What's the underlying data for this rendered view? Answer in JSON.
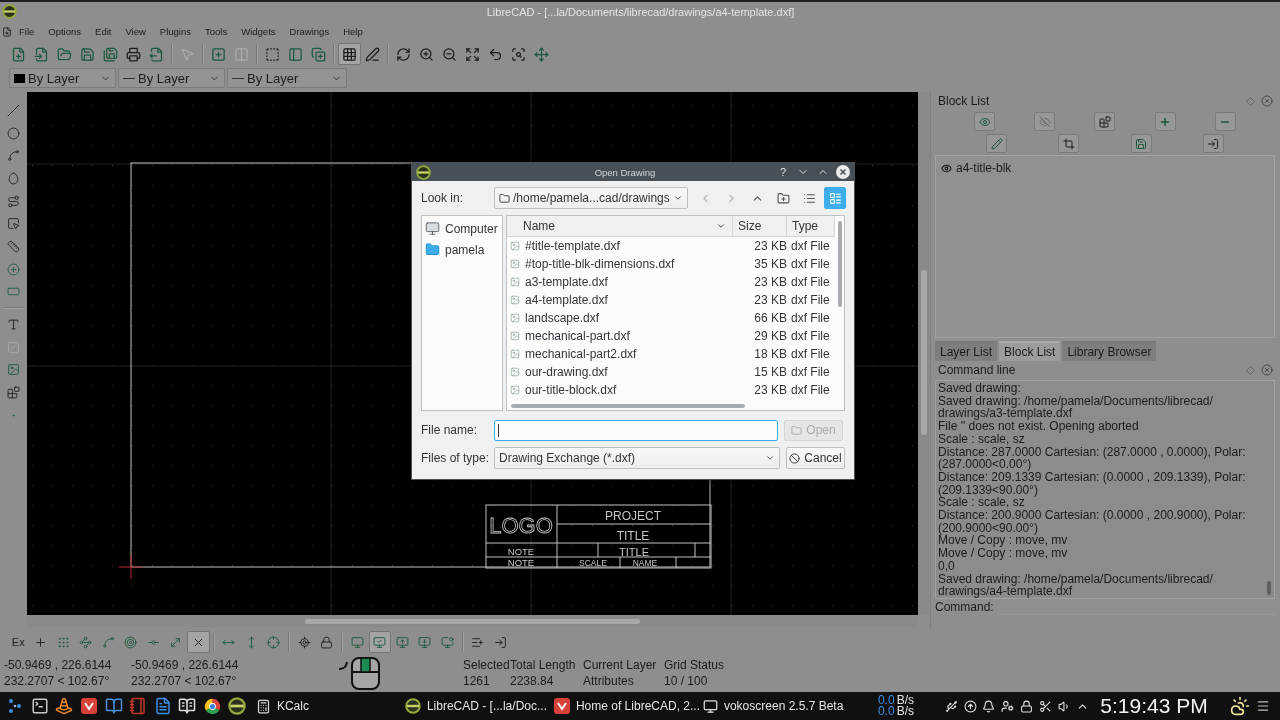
{
  "window": {
    "title": "LibreCAD - [...la/Documents/librecad/drawings/a4-template.dxf]"
  },
  "menu": [
    "File",
    "Options",
    "Edit",
    "View",
    "Plugins",
    "Tools",
    "Widgets",
    "Drawings",
    "Help"
  ],
  "main_toolbar": [
    [
      {
        "kind": "new",
        "on": false,
        "disabled": false
      },
      {
        "kind": "template",
        "on": false,
        "disabled": false
      },
      {
        "kind": "open",
        "on": false,
        "disabled": false
      },
      {
        "kind": "save",
        "on": false,
        "disabled": false
      },
      {
        "kind": "saveas",
        "on": false,
        "disabled": false
      },
      {
        "kind": "print",
        "on": false,
        "disabled": false
      },
      {
        "kind": "export",
        "on": false,
        "disabled": false
      }
    ],
    [
      {
        "kind": "select",
        "on": false,
        "disabled": true
      }
    ],
    [
      {
        "kind": "block",
        "on": false,
        "disabled": false
      },
      {
        "kind": "columns",
        "on": false,
        "disabled": true
      }
    ],
    [
      {
        "kind": "window",
        "on": false,
        "disabled": false
      },
      {
        "kind": "split",
        "on": false,
        "disabled": false
      },
      {
        "kind": "addview",
        "on": false,
        "disabled": false
      }
    ],
    [
      {
        "kind": "grid",
        "on": true,
        "disabled": false
      },
      {
        "kind": "draft",
        "on": false,
        "disabled": false
      }
    ],
    [
      {
        "kind": "redraw",
        "on": false,
        "disabled": false
      },
      {
        "kind": "zoomin",
        "on": false,
        "disabled": false
      },
      {
        "kind": "zoomout",
        "on": false,
        "disabled": false
      },
      {
        "kind": "autozoom",
        "on": false,
        "disabled": false
      },
      {
        "kind": "previous",
        "on": false,
        "disabled": false
      },
      {
        "kind": "zoomwindow",
        "on": false,
        "disabled": false
      },
      {
        "kind": "pan",
        "on": false,
        "disabled": false
      }
    ]
  ],
  "pen_toolbar": [
    {
      "kind": "color",
      "value": "By Layer"
    },
    {
      "kind": "width",
      "value": "By Layer"
    },
    {
      "kind": "linetype",
      "value": "By Layer"
    }
  ],
  "draw_toolbar": [
    [
      {
        "kind": "line",
        "disabled": false
      },
      {
        "kind": "circle",
        "disabled": false
      },
      {
        "kind": "spline",
        "disabled": false
      },
      {
        "kind": "ellipse",
        "disabled": false
      },
      {
        "kind": "polyline",
        "disabled": false
      },
      {
        "kind": "select",
        "disabled": false
      },
      {
        "kind": "dimension",
        "disabled": false
      },
      {
        "kind": "modify",
        "disabled": false
      },
      {
        "kind": "measure",
        "disabled": false
      }
    ],
    [
      {
        "kind": "text",
        "disabled": false
      },
      {
        "kind": "hatch",
        "disabled": true
      },
      {
        "kind": "image",
        "disabled": false
      },
      {
        "kind": "insert",
        "disabled": false
      },
      {
        "kind": "point",
        "disabled": false
      }
    ]
  ],
  "drawing": {
    "title_block": [
      "LOGO",
      "PROJECT",
      "TITLE",
      "NOTE",
      "TITLE",
      "NOTE",
      "SCALE",
      "NAME"
    ]
  },
  "open_dialog": {
    "title": "Open Drawing",
    "help": "?",
    "look_in_label": "Look in:",
    "look_in": "/home/pamela...cad/drawings",
    "nav_buttons": [
      {
        "kind": "back",
        "disabled": true,
        "selected": false
      },
      {
        "kind": "forward",
        "disabled": true,
        "selected": false
      },
      {
        "kind": "up",
        "disabled": false,
        "selected": false
      },
      {
        "kind": "newfolder",
        "disabled": false,
        "selected": false
      },
      {
        "kind": "listview",
        "disabled": false,
        "selected": false
      },
      {
        "kind": "detailview",
        "disabled": false,
        "selected": true
      }
    ],
    "places": [
      {
        "kind": "computer",
        "label": "Computer"
      },
      {
        "kind": "home",
        "label": "pamela"
      }
    ],
    "columns": [
      "Name",
      "Size",
      "Type"
    ],
    "files": [
      {
        "name": "#title-template.dxf",
        "size": "23 KB",
        "type": "dxf File"
      },
      {
        "name": "#top-title-blk-dimensions.dxf",
        "size": "35 KB",
        "type": "dxf File"
      },
      {
        "name": "a3-template.dxf",
        "size": "23 KB",
        "type": "dxf File"
      },
      {
        "name": "a4-template.dxf",
        "size": "23 KB",
        "type": "dxf File"
      },
      {
        "name": "landscape.dxf",
        "size": "66 KB",
        "type": "dxf File"
      },
      {
        "name": "mechanical-part.dxf",
        "size": "29 KB",
        "type": "dxf File"
      },
      {
        "name": "mechanical-part2.dxf",
        "size": "18 KB",
        "type": "dxf File"
      },
      {
        "name": "our-drawing.dxf",
        "size": "15 KB",
        "type": "dxf File"
      },
      {
        "name": "our-title-block.dxf",
        "size": "23 KB",
        "type": "dxf File"
      }
    ],
    "file_name": {
      "label": "File name:",
      "focused": true
    },
    "open_button": {
      "label": "Open",
      "disabled": true
    },
    "file_type": {
      "label": "Files of type:",
      "value": "Drawing Exchange (*.dxf)"
    },
    "cancel_button": {
      "label": "Cancel"
    }
  },
  "block_dock": {
    "title": "Block List",
    "blocks": [
      {
        "name": "a4-title-blk",
        "visible": true
      }
    ]
  },
  "dock_tabs": [
    {
      "label": "Layer List",
      "selected": false
    },
    {
      "label": "Block List",
      "selected": true
    },
    {
      "label": "Library Browser",
      "selected": false
    }
  ],
  "command_dock": {
    "title": "Command line",
    "lines": [
      "Saved drawing:",
      "Saved drawing: /home/pamela/Documents/librecad/",
      "drawings/a3-template.dxf",
      "File '' does not exist. Opening aborted",
      "Scale : scale, sz",
      "Distance: 287.0000 Cartesian: (287.0000 , 0.0000), Polar:",
      "(287.0000<0.00°)",
      "Distance: 209.1339 Cartesian: (0.0000 , 209.1339), Polar:",
      "(209.1339<90.00°)",
      "Scale : scale, sz",
      "Distance: 200.9000 Cartesian: (0.0000 , 200.9000), Polar:",
      "(200.9000<90.00°)",
      "Move / Copy : move, mv",
      "Move / Copy : move, mv",
      "0,0",
      "Saved drawing: /home/pamela/Documents/librecad/",
      "drawings/a4-template.dxf"
    ],
    "prompt": "Command:"
  },
  "snap_toolbar": [
    [
      {
        "kind": "exclusive",
        "label": "Ex",
        "on": false
      },
      {
        "kind": "free",
        "on": false
      },
      {
        "kind": "grid",
        "on": false
      },
      {
        "kind": "endpoint",
        "on": false
      },
      {
        "kind": "entity",
        "on": false
      },
      {
        "kind": "center",
        "on": false
      },
      {
        "kind": "middle",
        "on": false
      },
      {
        "kind": "distance",
        "on": false
      },
      {
        "kind": "intersection",
        "on": true
      }
    ],
    [
      {
        "kind": "horizontal",
        "on": false
      },
      {
        "kind": "vertical",
        "on": false
      },
      {
        "kind": "ortho",
        "on": false
      }
    ],
    [
      {
        "kind": "relzero",
        "on": false
      },
      {
        "kind": "lockzero",
        "on": false
      }
    ],
    [
      {
        "kind": "view1",
        "on": false
      },
      {
        "kind": "view2",
        "on": true
      },
      {
        "kind": "view3",
        "on": false
      },
      {
        "kind": "view4",
        "on": false
      },
      {
        "kind": "view5",
        "on": false
      }
    ],
    [
      {
        "kind": "addleft",
        "on": false
      },
      {
        "kind": "addright",
        "on": false
      }
    ]
  ],
  "status": {
    "coordinates": [
      {
        "cartesian": "-50.9469 , 226.6144",
        "polar": "232.2707 < 102.67°"
      },
      {
        "cartesian": "-50.9469 , 226.6144",
        "polar": "232.2707 < 102.67°"
      }
    ],
    "fields": [
      {
        "label": "Selected",
        "value": "1261"
      },
      {
        "label": "Total Length",
        "value": "2238.84"
      },
      {
        "label": "Current Layer",
        "value": "Attributes"
      },
      {
        "label": "Grid Status",
        "value": "10 / 100"
      }
    ]
  },
  "taskbar": {
    "tasks": [
      {
        "kind": "calc",
        "label": "KCalc"
      },
      {
        "kind": "librecad",
        "label": "LibreCAD - [...la/Doc..."
      },
      {
        "kind": "vivaldi",
        "label": "Home of LibreCAD, 2..."
      },
      {
        "kind": "recorder",
        "label": "vokoscreen 2.5.7 Beta"
      }
    ],
    "net_speed": [
      {
        "value": "0.0",
        "unit": "B/s"
      },
      {
        "value": "0.0",
        "unit": "B/s"
      }
    ],
    "clock": "5:19:43 PM"
  }
}
